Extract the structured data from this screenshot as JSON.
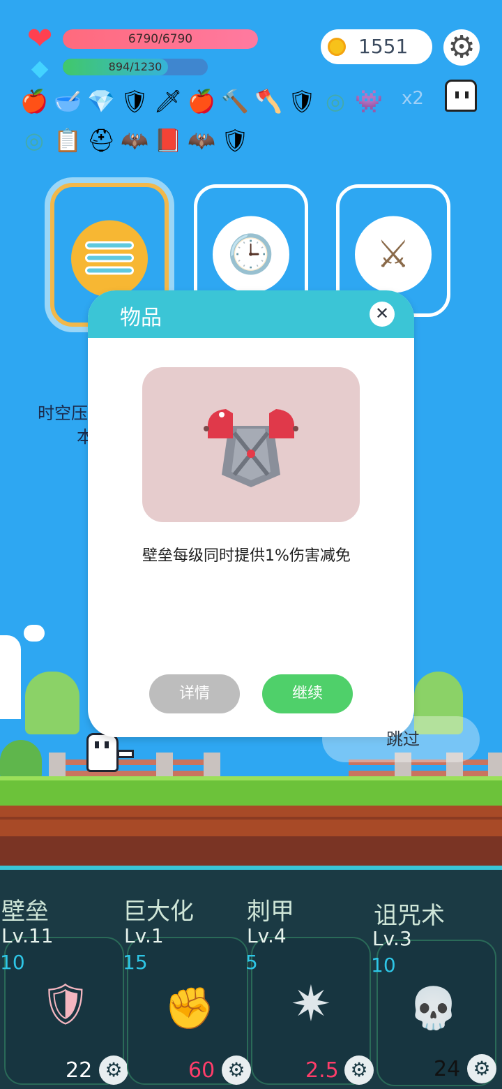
{
  "hud": {
    "hp": {
      "icon": "heart-icon",
      "text": "6790/6790",
      "fraction": 1.0,
      "glyph": "❤"
    },
    "mp": {
      "icon": "diamond-icon",
      "text": "894/1230",
      "fraction": 0.727,
      "glyph": "◆"
    },
    "coins": {
      "icon": "coin-icon",
      "value": "1551"
    },
    "settings": {
      "icon": "gear-icon",
      "glyph": "⚙"
    },
    "ghost": {
      "icon": "ghost-icon"
    }
  },
  "items_row1": [
    {
      "icon": "apple-icon",
      "glyph": "🍎"
    },
    {
      "icon": "mortar-icon",
      "glyph": "🥣"
    },
    {
      "icon": "diamond-icon",
      "glyph": "💎"
    },
    {
      "icon": "armor-icon",
      "glyph": "🛡"
    },
    {
      "icon": "sword-icon",
      "glyph": "🗡"
    },
    {
      "icon": "apple-icon",
      "glyph": "🍎"
    },
    {
      "icon": "hammer-icon",
      "glyph": "🔨"
    },
    {
      "icon": "axe-icon",
      "glyph": "🪓"
    },
    {
      "icon": "armor-icon",
      "glyph": "🛡"
    },
    {
      "icon": "ring-icon",
      "glyph": "◎"
    },
    {
      "icon": "slime-icon",
      "glyph": "👾"
    }
  ],
  "items_multiplier": "x2",
  "items_row2": [
    {
      "icon": "ring-icon",
      "glyph": "◎"
    },
    {
      "icon": "list-icon",
      "glyph": "📋"
    },
    {
      "icon": "helmet-icon",
      "glyph": "⛑"
    },
    {
      "icon": "bat-icon",
      "glyph": "🦇"
    },
    {
      "icon": "skull-book-icon",
      "glyph": "📕"
    },
    {
      "icon": "bat-icon",
      "glyph": "🦇"
    },
    {
      "icon": "armor-icon",
      "glyph": "🛡"
    }
  ],
  "cards": [
    {
      "icon": "list-refresh-icon",
      "selected": true
    },
    {
      "icon": "gauge-icon",
      "glyph": "🕒",
      "selected": false
    },
    {
      "icon": "crossed-swords-icon",
      "glyph": "⚔",
      "selected": false
    }
  ],
  "behind_text": {
    "line1": "时空压",
    "line2": "本"
  },
  "dialog": {
    "title": "物品",
    "close_glyph": "✕",
    "item_icon": "armor-icon",
    "description": "壁垒每级同时提供1%伤害减免",
    "details_label": "详情",
    "continue_label": "继续"
  },
  "skip_label": "跳过",
  "skills": [
    {
      "name": "壁垒",
      "level": "Lv.11",
      "cost": "10",
      "icon": "armor-icon",
      "glyph": "🛡",
      "value": "22",
      "value_color": "#ffffff"
    },
    {
      "name": "巨大化",
      "level": "Lv.1",
      "cost": "15",
      "icon": "fist-icon",
      "glyph": "✊",
      "value": "60",
      "value_color": "#ff3d6a"
    },
    {
      "name": "刺甲",
      "level": "Lv.4",
      "cost": "5",
      "icon": "spiked-mace-icon",
      "glyph": "✷",
      "value": "2.5",
      "value_color": "#ff3d6a"
    },
    {
      "name": "诅咒术",
      "level": "Lv.3",
      "cost": "10",
      "icon": "skull-icon",
      "glyph": "💀",
      "value": "24",
      "value_color": "#111111"
    }
  ]
}
